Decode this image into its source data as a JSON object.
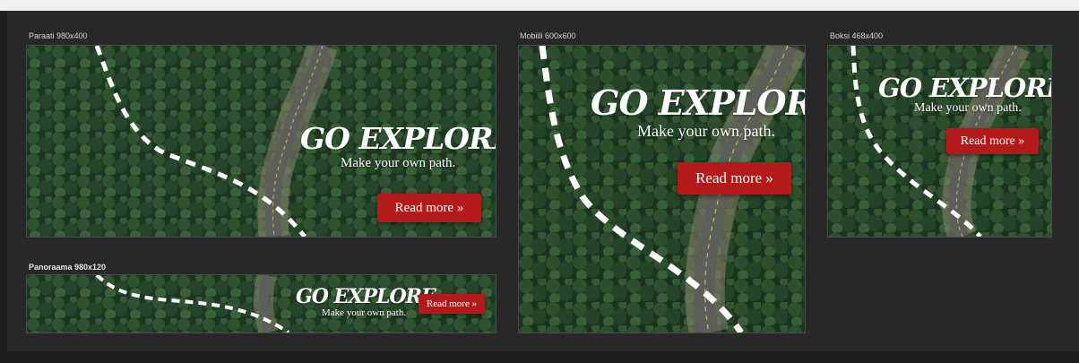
{
  "banner": {
    "headline": "GO EXPLORE",
    "tagline": "Make your own path.",
    "cta_label": "Read more »"
  },
  "artboards": [
    {
      "label": "Paraati 980x400"
    },
    {
      "label": "Panoraama 980x120"
    },
    {
      "label": "Mobiili 600x600"
    },
    {
      "label": "Boksi 468x400"
    }
  ],
  "colors": {
    "workspace": "#282828",
    "forest_dark": "#1c3320",
    "forest_mid": "#2e4f2e",
    "road": "#5f615d",
    "cta": "#b31b1b",
    "path_dash": "#ffffff"
  }
}
